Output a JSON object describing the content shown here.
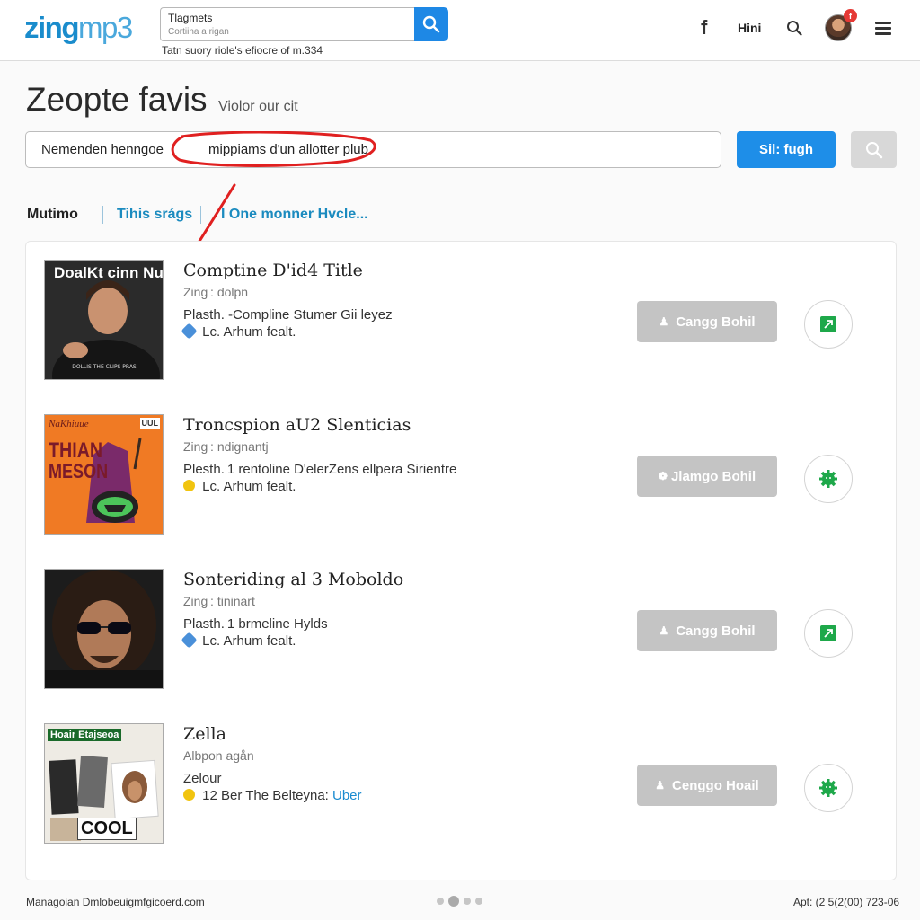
{
  "header": {
    "logo_part1": "zing",
    "logo_part2": "mp3",
    "search_value": "Tlagmets",
    "search_placeholder": "Cortiina a rigan",
    "search_hint": "Tatn suory riole's efiocre of m.334",
    "facebook_label": "f",
    "user_label": "Hini",
    "notification_count": "f"
  },
  "page": {
    "title": "Zeopte favis",
    "subtitle": "Violor our cit"
  },
  "main_search": {
    "label": "Nemenden henngoe",
    "value": "mippiams d'un allotter plub",
    "submit_label": "Sil: fugh"
  },
  "tabs": [
    {
      "label": "Mutimo"
    },
    {
      "label": "Tihis srágs"
    },
    {
      "label": "I One monner Hvcle..."
    }
  ],
  "results": [
    {
      "title": "Comptine D'id4 Title",
      "subtitle": "Zing : dolpn",
      "description": "Plasth. -Compline Stumer Gii leyez",
      "meta_prefix": "Lc.",
      "meta_text": "Arhum fealt.",
      "meta_link": "",
      "meta_icon": "blue-badge-icon",
      "action_label": "Cangg Bohil",
      "action_icon": "user-icon",
      "side_icon": "external-link-icon",
      "cover_text": "DoalKt cinn NuK."
    },
    {
      "title": "Troncspion aU2 Slenticias",
      "subtitle": "Zing : ndignantj",
      "description": "Plesth. 1 rentoline D'elerZens ellpera Sirientre",
      "meta_prefix": "Lc.",
      "meta_text": "Arhum fealt.",
      "meta_link": "",
      "meta_icon": "yellow-smile-icon",
      "action_label": "Jlamgo Bohil",
      "action_icon": "gear-icon",
      "side_icon": "green-gear-icon",
      "cover_text_1": "THIAN",
      "cover_text_2": "MESON",
      "cover_text_small": "NaKhiuue",
      "cover_text_corner": "UUL"
    },
    {
      "title": "Sonteriding al 3 Moboldo",
      "subtitle": "Zing : tininart",
      "description": "Plasth. 1 brmeline Hylds",
      "meta_prefix": "Lc.",
      "meta_text": "Arhum fealt.",
      "meta_link": "",
      "meta_icon": "blue-badge-icon",
      "action_label": "Cangg Bohil",
      "action_icon": "user-icon",
      "side_icon": "external-link-icon"
    },
    {
      "title": "Zella",
      "subtitle": "Albpon agån",
      "description": "Zelour",
      "meta_prefix": "12",
      "meta_text": "Ber The Belteyna:",
      "meta_link": "Uber",
      "meta_icon": "yellow-smile-icon",
      "action_label": "Cenggo Hoail",
      "action_icon": "user-icon",
      "side_icon": "green-gear-icon",
      "cover_text_1": "Hoair Etajseoa",
      "cover_text_2": "COOL"
    }
  ],
  "footer": {
    "left_text": "Managoian Dmlobeuigmfgicoerd.com",
    "right_text": "Apt: (2 5(2(00) 723-06"
  },
  "colors": {
    "accent": "#1e88e5",
    "link": "#1b8bbf",
    "annotation_red": "#e02020",
    "button_gray": "#c4c4c4",
    "icon_green": "#1ea84a"
  }
}
